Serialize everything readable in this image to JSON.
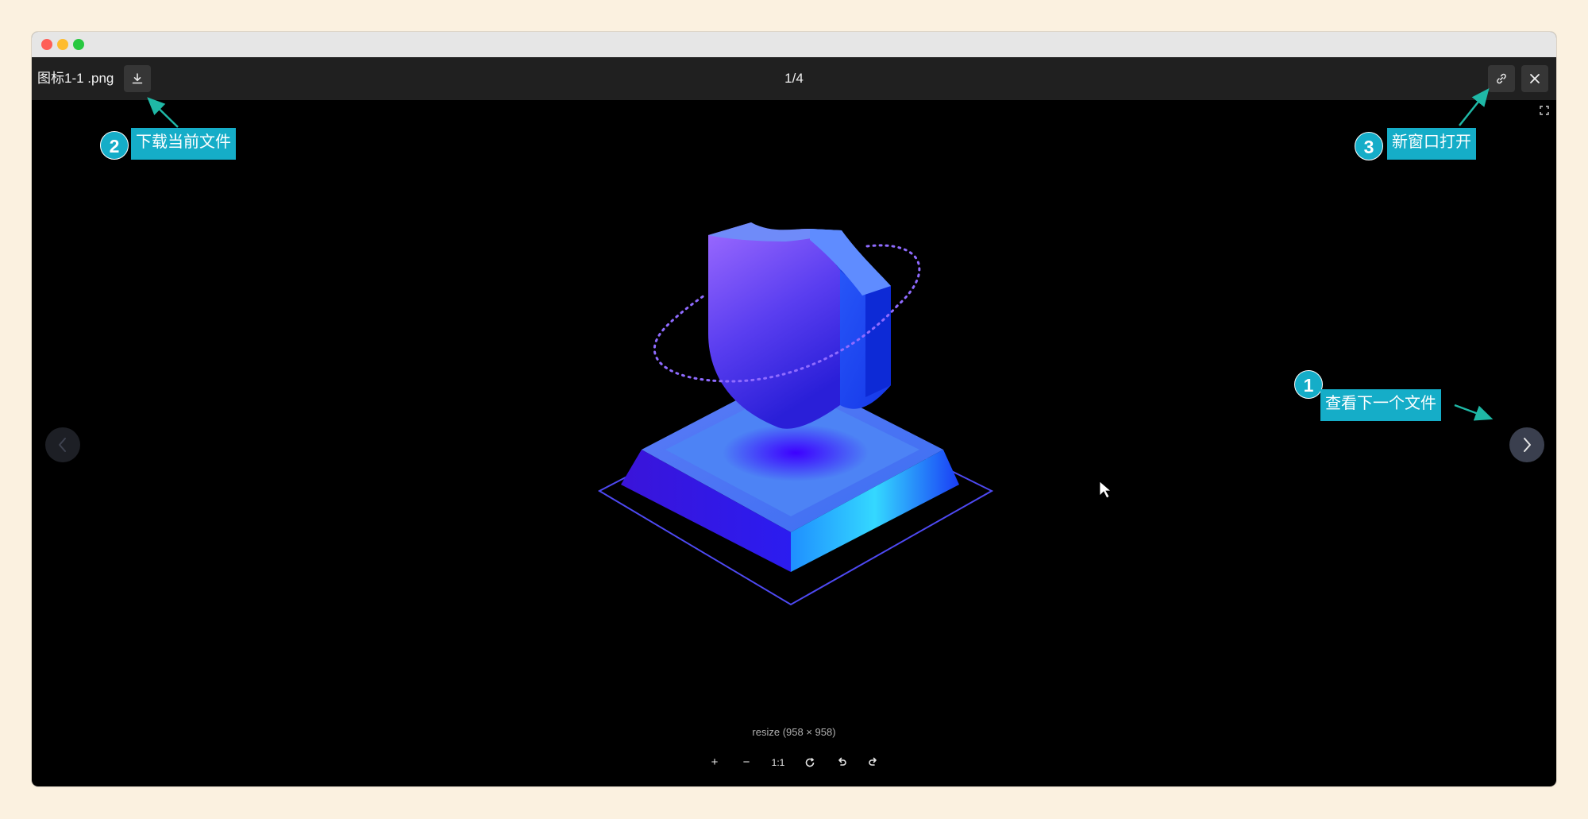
{
  "window": {
    "buttons": [
      "close",
      "minimize",
      "maximize"
    ]
  },
  "toolbar": {
    "filename": "图标1-1 .png",
    "download_icon": "download-icon",
    "counter": "1/4",
    "link_icon": "link-icon",
    "close_icon": "close-icon"
  },
  "viewer": {
    "prev_icon": "chevron-left-icon",
    "next_icon": "chevron-right-icon",
    "fullscreen_icon": "fullscreen-icon",
    "image_alt": "shield-illustration",
    "resize_text": "resize (958 × 958)"
  },
  "controls": [
    {
      "name": "zoom-in",
      "label": "+"
    },
    {
      "name": "zoom-out",
      "label": "−"
    },
    {
      "name": "actual-size",
      "label": "1:1"
    },
    {
      "name": "rotate",
      "label": "rotate-icon"
    },
    {
      "name": "undo",
      "label": "undo-icon"
    },
    {
      "name": "redo",
      "label": "redo-icon"
    }
  ],
  "annotations": [
    {
      "number": "1",
      "text": "查看下一个文件"
    },
    {
      "number": "2",
      "text": "下载当前文件"
    },
    {
      "number": "3",
      "text": "新窗口打开"
    }
  ],
  "colors": {
    "accent": "#15adc8",
    "arrow": "#1fb8a6",
    "page_bg": "#fbf1e0",
    "toolbar_bg": "#202020"
  }
}
